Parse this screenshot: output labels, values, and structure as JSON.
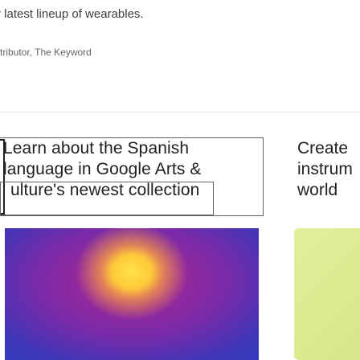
{
  "article": {
    "intro_text": "r latest lineup of wearables.",
    "byline": "tributor, The Keyword"
  },
  "cards": [
    {
      "title_lines": [
        "Learn about the Spanish",
        "language in Google Arts &",
        "ulture's newest collection"
      ]
    },
    {
      "title_lines": [
        "Create ",
        "instrum",
        "world"
      ]
    }
  ],
  "colors": {
    "image_left_core": "#ffe24a",
    "image_left_edge": "#2b3fc0",
    "image_right": "#dbe98f"
  }
}
